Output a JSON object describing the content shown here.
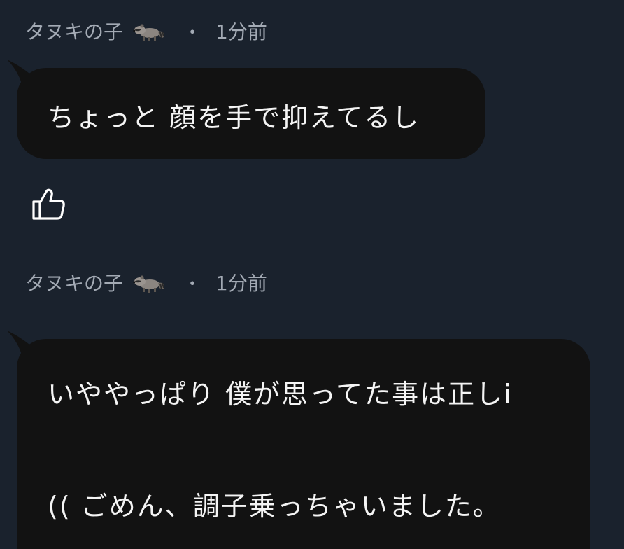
{
  "comments": [
    {
      "author": "タヌキの子",
      "author_icon": "raccoon-emoji",
      "separator": "・",
      "time": "1分前",
      "message_lines": [
        "ちょっと 顔を手で抑えてるし"
      ],
      "like_icon": "thumbs-up-icon"
    },
    {
      "author": "タヌキの子",
      "author_icon": "raccoon-emoji",
      "separator": "・",
      "time": "1分前",
      "message_lines": [
        "いややっぱり 僕が思ってた事は正しi",
        "",
        "(( ごめん、調子乗っちゃいました。"
      ]
    }
  ],
  "colors": {
    "background": "#1a222d",
    "bubble": "#121212",
    "meta_text": "#a3aab4",
    "message_text": "#f4f4f4",
    "divider": "#2c3644"
  }
}
